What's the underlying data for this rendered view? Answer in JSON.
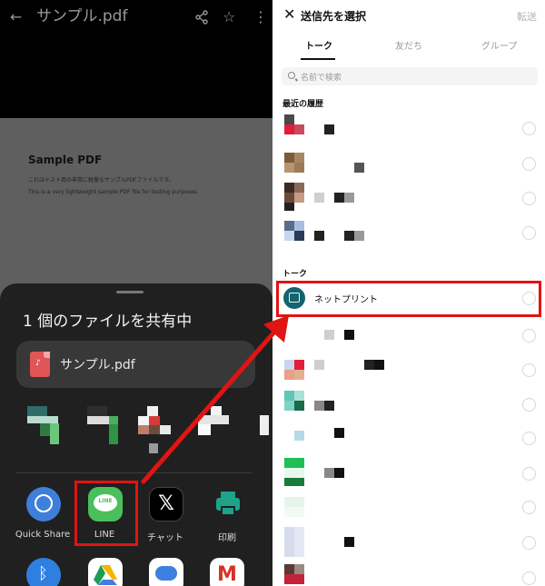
{
  "left": {
    "viewer": {
      "title": "サンプル.pdf",
      "back_icon": "arrow-left-icon",
      "share_icon": "share-icon",
      "star_icon": "star-outline-icon",
      "more_icon": "more-vertical-icon"
    },
    "document": {
      "heading": "Sample PDF",
      "line_jp": "これはテスト用の非常に軽量なサンプルPDFファイルです。",
      "line_en": "This is a very lightweight sample PDF file for testing purposes."
    },
    "share_sheet": {
      "title": "1 個のファイルを共有中",
      "file_name": "サンプル.pdf",
      "file_icon": "pdf-file-icon",
      "apps": [
        {
          "label": "Quick Share",
          "icon": "quick-share-icon"
        },
        {
          "label": "LINE",
          "icon": "line-icon",
          "icon_text": "LINE"
        },
        {
          "label": "チャット",
          "icon": "x-icon",
          "icon_text": "𝕏"
        },
        {
          "label": "印刷",
          "icon": "printer-icon"
        }
      ],
      "second_row_icons": [
        "bluetooth-icon",
        "google-drive-icon",
        "google-messages-icon",
        "gmail-icon"
      ]
    }
  },
  "right": {
    "header": {
      "close_icon": "close-icon",
      "title": "送信先を選択",
      "forward_label": "転送"
    },
    "tabs": [
      {
        "label": "トーク",
        "active": true
      },
      {
        "label": "友だち",
        "active": false
      },
      {
        "label": "グループ",
        "active": false
      }
    ],
    "search": {
      "placeholder": "名前で検索"
    },
    "sections": {
      "recent": "最近の履歴",
      "talk": "トーク"
    },
    "highlighted_contact": {
      "name": "ネットプリント",
      "avatar_icon": "netprint-icon"
    }
  },
  "annotation": {
    "highlight_color": "#e01414"
  }
}
